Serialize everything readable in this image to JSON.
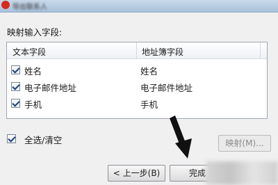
{
  "title": {
    "text": "导出联系人"
  },
  "section_label": "映射输入字段:",
  "list": {
    "columns": [
      "文本字段",
      "地址簿字段"
    ],
    "rows": [
      {
        "checked": true,
        "source": "姓名",
        "target": "姓名"
      },
      {
        "checked": true,
        "source": "电子邮件地址",
        "target": "电子邮件地址"
      },
      {
        "checked": true,
        "source": "手机",
        "target": "手机"
      }
    ]
  },
  "select_all": {
    "checked": true,
    "label": "全选/清空"
  },
  "buttons": {
    "map": "映射(M)...",
    "back": "< 上一步(B)",
    "finish": "完成"
  }
}
